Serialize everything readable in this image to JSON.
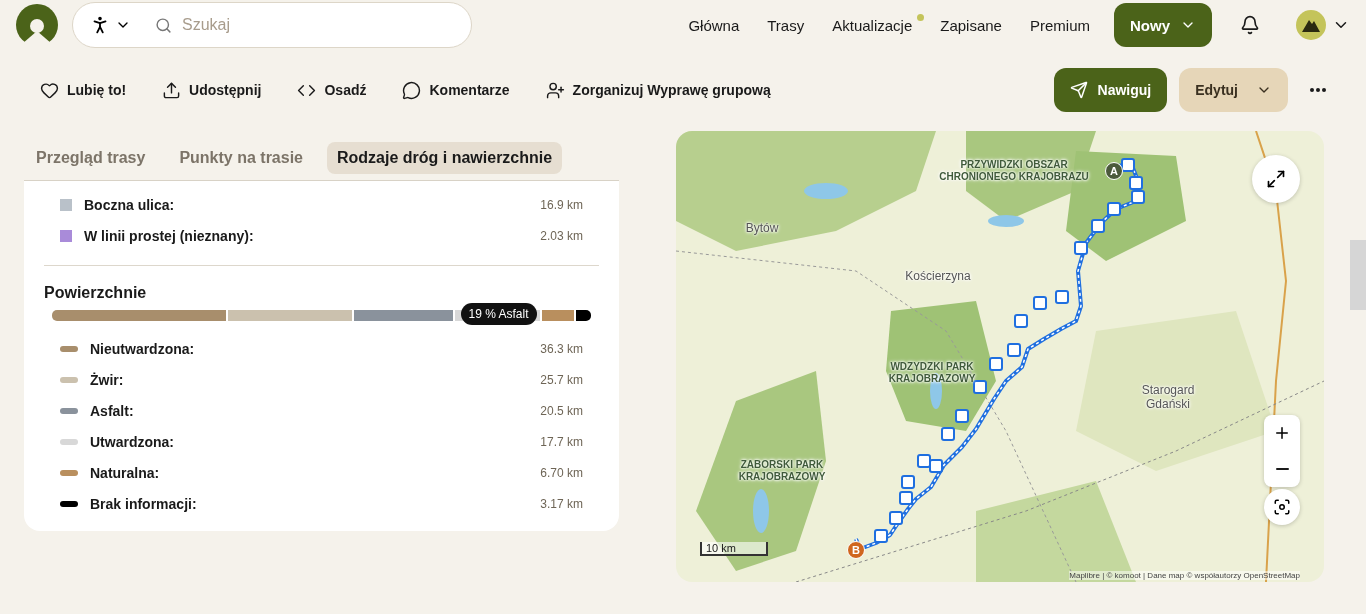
{
  "header": {
    "search": {
      "placeholder": "Szukaj"
    },
    "nav": [
      {
        "label": "Główna",
        "badge": false
      },
      {
        "label": "Trasy",
        "badge": false
      },
      {
        "label": "Aktualizacje",
        "badge": true
      },
      {
        "label": "Zapisane",
        "badge": false
      },
      {
        "label": "Premium",
        "badge": false
      }
    ],
    "new_button": "Nowy"
  },
  "actions": [
    {
      "kind": "like",
      "label": "Lubię to!"
    },
    {
      "kind": "share",
      "label": "Udostępnij"
    },
    {
      "kind": "embed",
      "label": "Osadź"
    },
    {
      "kind": "comments",
      "label": "Komentarze"
    },
    {
      "kind": "group",
      "label": "Zorganizuj Wyprawę grupową"
    }
  ],
  "navigate_button": "Nawiguj",
  "edit_button": "Edytuj",
  "tabs": [
    {
      "label": "Przegląd trasy",
      "selected": false
    },
    {
      "label": "Punkty na trasie",
      "selected": false
    },
    {
      "label": "Rodzaje dróg i nawierzchnie",
      "selected": true
    }
  ],
  "road_types": [
    {
      "name": "Boczna ulica:",
      "distance": "16.9 km",
      "color": "#b9c1c9"
    },
    {
      "name": "W linii prostej (nieznany):",
      "distance": "2.03 km",
      "color": "#a98bd9"
    }
  ],
  "surfaces": {
    "title": "Powierzchnie",
    "tooltip": "19 % Asfalt",
    "items": [
      {
        "name": "Nieutwardzona:",
        "distance": "36.3 km",
        "color": "#a88e6c",
        "highlighted": false
      },
      {
        "name": "Żwir:",
        "distance": "25.7 km",
        "color": "#cbc1ae",
        "highlighted": false
      },
      {
        "name": "Asfalt:",
        "distance": "20.5 km",
        "color": "#8a929c",
        "highlighted": false
      },
      {
        "name": "Utwardzona:",
        "distance": "17.7 km",
        "color": "#d8d8d8",
        "highlighted": true
      },
      {
        "name": "Naturalna:",
        "distance": "6.70 km",
        "color": "#b98f5e",
        "highlighted": false
      },
      {
        "name": "Brak informacji:",
        "distance": "3.17 km",
        "color": "#000000",
        "highlighted": false
      }
    ]
  },
  "map": {
    "labels": [
      {
        "kind": "town",
        "text": "Bytów"
      },
      {
        "kind": "town",
        "text": "Kościerzyna"
      },
      {
        "kind": "town",
        "text": "Starogard Gdański"
      },
      {
        "kind": "park",
        "text": "PRZYWIDZKI OBSZAR CHRONIONEGO KRAJOBRAZU"
      },
      {
        "kind": "park",
        "text": "WDZYDZKI PARK KRAJOBRAZOWY"
      },
      {
        "kind": "park",
        "text": "ZABORSKI PARK KRAJOBRAZOWY"
      }
    ],
    "start": "A",
    "end": "B",
    "scale": "10 km",
    "attribution": "Maplibre | © komoot | Dane map © współautorzy OpenStreetMap"
  }
}
